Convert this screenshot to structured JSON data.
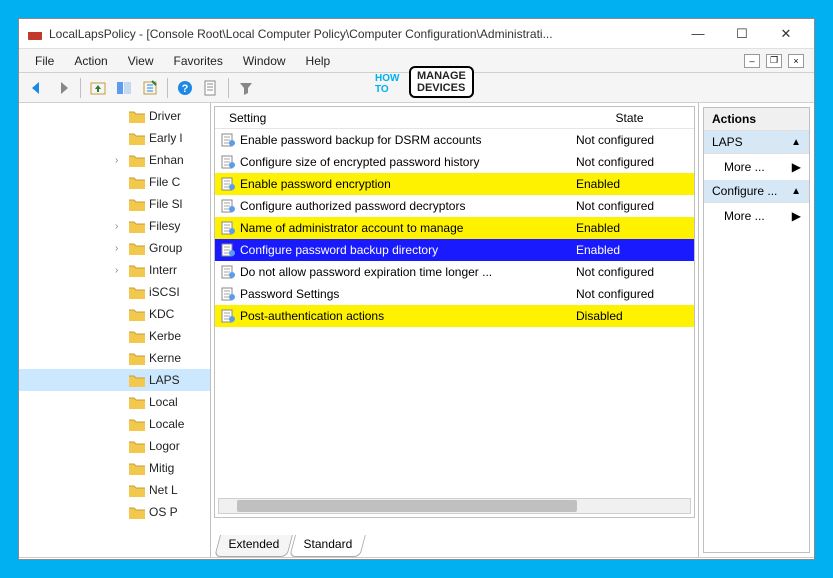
{
  "titlebar": {
    "app_name": "LocalLapsPolicy",
    "path": "[Console Root\\Local Computer Policy\\Computer Configuration\\Administrati..."
  },
  "menu": [
    "File",
    "Action",
    "View",
    "Favorites",
    "Window",
    "Help"
  ],
  "watermark": {
    "pre": "HOW\nTO",
    "main": "MANAGE\nDEVICES"
  },
  "tree": [
    {
      "label": "Driver",
      "expandable": false
    },
    {
      "label": "Early l",
      "expandable": false
    },
    {
      "label": "Enhan",
      "expandable": true
    },
    {
      "label": "File C",
      "expandable": false
    },
    {
      "label": "File Sl",
      "expandable": false
    },
    {
      "label": "Filesy",
      "expandable": true
    },
    {
      "label": "Group",
      "expandable": true
    },
    {
      "label": "Interr",
      "expandable": true
    },
    {
      "label": "iSCSI",
      "expandable": false
    },
    {
      "label": "KDC",
      "expandable": false
    },
    {
      "label": "Kerbe",
      "expandable": false
    },
    {
      "label": "Kerne",
      "expandable": false
    },
    {
      "label": "LAPS",
      "expandable": false,
      "selected": true
    },
    {
      "label": "Local",
      "expandable": false
    },
    {
      "label": "Locale",
      "expandable": false
    },
    {
      "label": "Logor",
      "expandable": false
    },
    {
      "label": "Mitig",
      "expandable": false
    },
    {
      "label": "Net L",
      "expandable": false
    },
    {
      "label": "OS P",
      "expandable": false
    }
  ],
  "columns": {
    "setting": "Setting",
    "state": "State"
  },
  "settings": [
    {
      "name": "Enable password backup for DSRM accounts",
      "state": "Not configured",
      "style": "normal"
    },
    {
      "name": "Configure size of encrypted password history",
      "state": "Not configured",
      "style": "normal"
    },
    {
      "name": "Enable password encryption",
      "state": "Enabled",
      "style": "highlight"
    },
    {
      "name": "Configure authorized password decryptors",
      "state": "Not configured",
      "style": "normal"
    },
    {
      "name": "Name of administrator account to manage",
      "state": "Enabled",
      "style": "highlight"
    },
    {
      "name": "Configure password backup directory",
      "state": "Enabled",
      "style": "selected"
    },
    {
      "name": "Do not allow password expiration time longer ...",
      "state": "Not configured",
      "style": "normal"
    },
    {
      "name": "Password Settings",
      "state": "Not configured",
      "style": "normal"
    },
    {
      "name": "Post-authentication actions",
      "state": "Disabled",
      "style": "highlight"
    }
  ],
  "tabs": {
    "extended": "Extended",
    "standard": "Standard"
  },
  "actions": {
    "title": "Actions",
    "section1": "LAPS",
    "more": "More ...",
    "section2": "Configure ..."
  }
}
